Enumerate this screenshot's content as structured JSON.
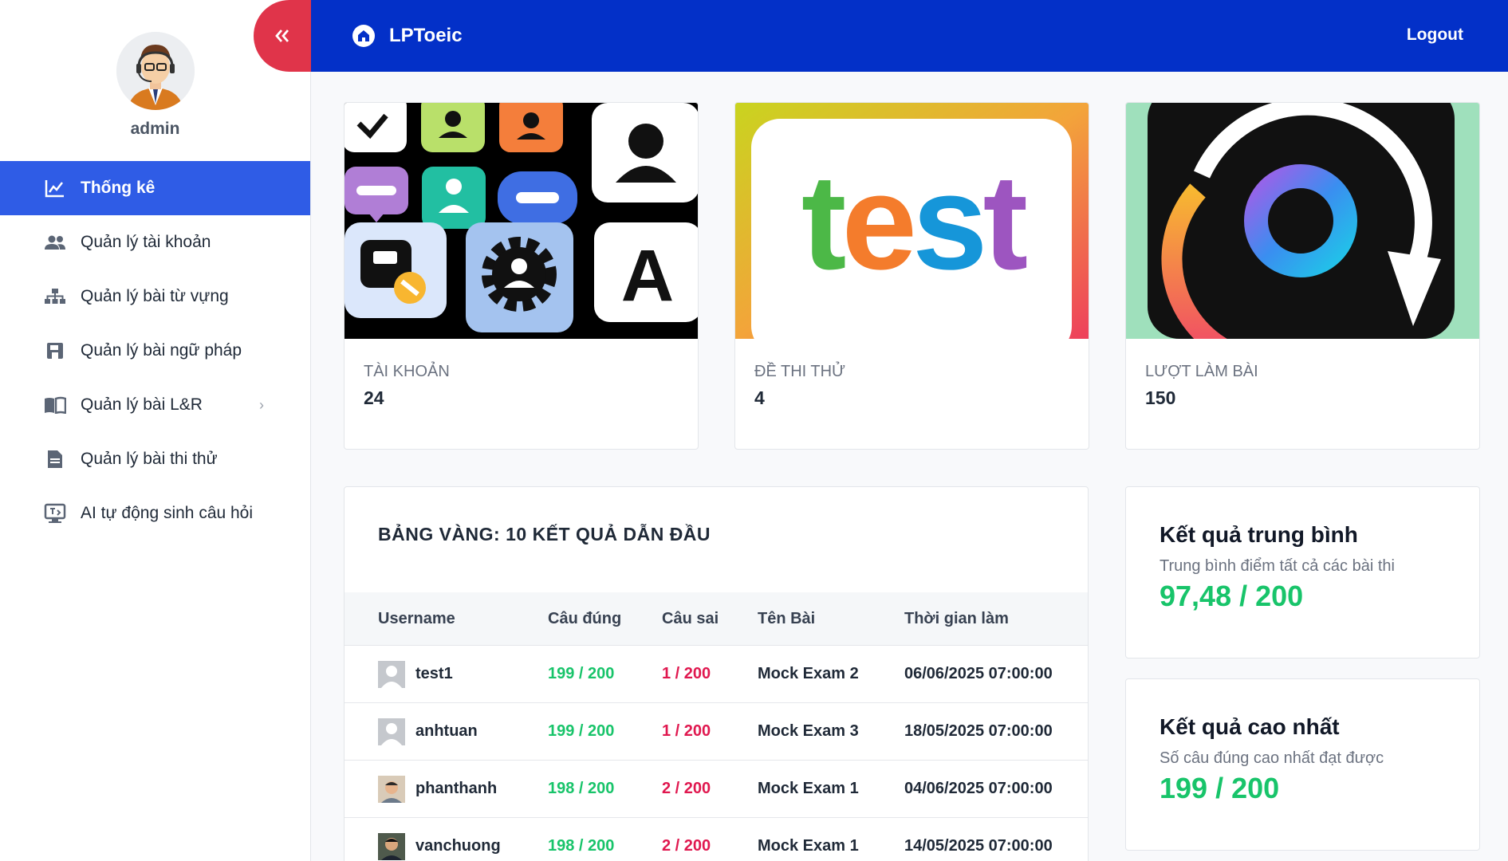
{
  "sidebar": {
    "username": "admin",
    "menu": [
      {
        "label": "Thống kê",
        "icon": "chart-line-icon",
        "active": true
      },
      {
        "label": "Quản lý tài khoản",
        "icon": "users-icon"
      },
      {
        "label": "Quản lý bài từ vựng",
        "icon": "sitemap-icon"
      },
      {
        "label": "Quản lý bài ngữ pháp",
        "icon": "save-icon"
      },
      {
        "label": "Quản lý bài L&R",
        "icon": "book-open-icon",
        "has_submenu": true
      },
      {
        "label": "Quản lý bài thi thử",
        "icon": "document-icon"
      },
      {
        "label": "AI tự động sinh câu hỏi",
        "icon": "ai-screen-icon"
      }
    ]
  },
  "header": {
    "brand": "LPToeic",
    "logout": "Logout"
  },
  "stats": [
    {
      "label": "TÀI KHOẢN",
      "value": "24"
    },
    {
      "label": "ĐỀ THI THỬ",
      "value": "4"
    },
    {
      "label": "LƯỢT LÀM BÀI",
      "value": "150"
    }
  ],
  "stat_images": {
    "test_word": "test"
  },
  "leaderboard": {
    "title": "BẢNG VÀNG: 10 KẾT QUẢ DẪN ĐẦU",
    "columns": [
      "Username",
      "Câu đúng",
      "Câu sai",
      "Tên Bài",
      "Thời gian làm"
    ],
    "rows": [
      {
        "username": "test1",
        "correct": "199 / 200",
        "wrong": "1 / 200",
        "exam": "Mock Exam 2",
        "time": "06/06/2025 07:00:00"
      },
      {
        "username": "anhtuan",
        "correct": "199 / 200",
        "wrong": "1 / 200",
        "exam": "Mock Exam 3",
        "time": "18/05/2025 07:00:00"
      },
      {
        "username": "phanthanh",
        "correct": "198 / 200",
        "wrong": "2 / 200",
        "exam": "Mock Exam 1",
        "time": "04/06/2025 07:00:00"
      },
      {
        "username": "vanchuong",
        "correct": "198 / 200",
        "wrong": "2 / 200",
        "exam": "Mock Exam 1",
        "time": "14/05/2025 07:00:00"
      }
    ]
  },
  "average": {
    "title": "Kết quả trung bình",
    "subtitle": "Trung bình điểm tất cả các bài thi",
    "value": "97,48 / 200"
  },
  "highest": {
    "title": "Kết quả cao nhất",
    "subtitle": "Số câu đúng cao nhất đạt được",
    "value": "199 / 200"
  },
  "colors": {
    "primary": "#0330c8",
    "active_menu": "#2f5ce6",
    "collapse": "#e0344a",
    "correct": "#18c46a",
    "wrong": "#e0184f"
  }
}
